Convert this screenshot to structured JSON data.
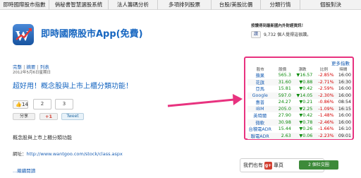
{
  "nav": {
    "items": [
      "即時國際股市指數",
      "俏秘書智慧選股系統",
      "法人籌碼分析",
      "多項排列股票",
      "台股/美股比價",
      "分類行情",
      "個股對決"
    ]
  },
  "app": {
    "title": "即時國際股市App(免費)",
    "logo_icon": "wantgoo-logo"
  },
  "meta": {
    "link_full": "完整",
    "link_summary": "摘要",
    "link_list": "列表",
    "separator": "|",
    "date": "2012年5月6日星期日"
  },
  "headline": "超好用！概念股與上市上櫃分類功能！",
  "social": {
    "like_label": "👍",
    "like_count": "14",
    "count_2": "2",
    "count_3": "3",
    "share_label": "分享",
    "gplus_label": "+1",
    "tweet_label": "Tweet"
  },
  "body": {
    "text": "概念股與上市上櫃分類功能",
    "url_prefix": "網址：",
    "url": "http://www.wantgoo.com/stock/class.aspx",
    "read_more": "...繼續閱讀"
  },
  "sidebar": {
    "follow_text": "按讚得到最新國內外財經資訊！",
    "fb_like_label": "讚",
    "fb_like_text": "9,732 個人覺得這很讚。"
  },
  "stock_panel": {
    "more_label": "更多指數",
    "headers": [
      "股市",
      "股價",
      "漲跌",
      "比例",
      "時間"
    ],
    "rows": [
      {
        "name": "蘋果",
        "price": "565.3",
        "chg": "▼16.57",
        "pct": "-2.85%",
        "time": "16:00"
      },
      {
        "name": "花旗",
        "price": "31.60",
        "chg": "▼0.88",
        "pct": "-2.71%",
        "time": "16:30"
      },
      {
        "name": "亞馬",
        "price": "15.81",
        "chg": "▼0.42",
        "pct": "-2.59%",
        "time": "16:00"
      },
      {
        "name": "Google",
        "price": "597.0",
        "chg": "▼14.05",
        "pct": "-2.30%",
        "time": "16:00"
      },
      {
        "name": "惠普",
        "price": "24.27",
        "chg": "▼0.21",
        "pct": "-0.86%",
        "time": "08:54"
      },
      {
        "name": "IBM",
        "price": "205.0",
        "chg": "▼2.25",
        "pct": "-1.09%",
        "time": "16:15"
      },
      {
        "name": "英特爾",
        "price": "27.90",
        "chg": "▼0.42",
        "pct": "-1.48%",
        "time": "16:00"
      },
      {
        "name": "微軟",
        "price": "30.98",
        "chg": "▼0.78",
        "pct": "-2.46%",
        "time": "16:00"
      },
      {
        "name": "台積電ADR",
        "price": "15.44",
        "chg": "▼0.26",
        "pct": "-1.66%",
        "time": "16:10"
      },
      {
        "name": "聯電ADR",
        "price": "2.63",
        "chg": "▼0.06",
        "pct": "-2.23%",
        "time": "09:01"
      }
    ]
  },
  "gplus_box": {
    "text_before": "我們也有",
    "icon": "g+",
    "text_after": "專頁",
    "chip_label": "2 個社交圈"
  },
  "colors": {
    "accent_pink": "#e8327f",
    "link_blue": "#1a5fb4",
    "up_green": "#0a8a0a",
    "down_red": "#d40000"
  }
}
